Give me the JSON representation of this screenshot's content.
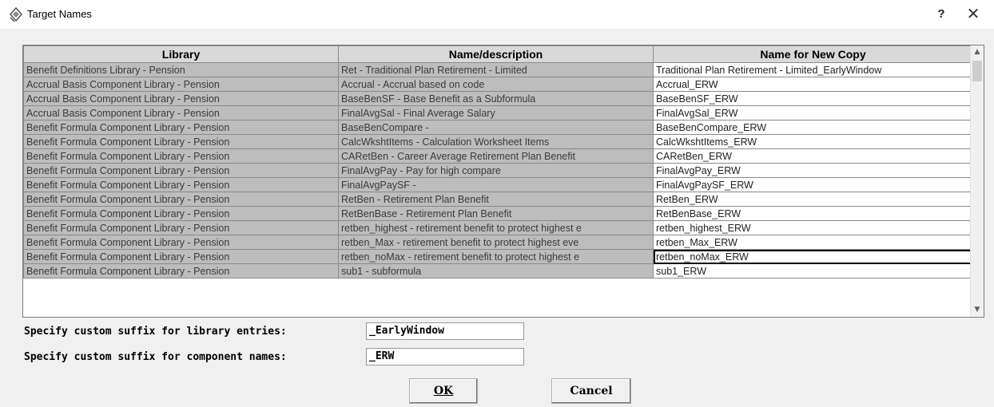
{
  "window": {
    "title": "Target Names",
    "help_label": "?",
    "close_label": "✕",
    "icon": "app-icon"
  },
  "table": {
    "columns": [
      "Library",
      "Name/description",
      "Name for New Copy"
    ],
    "rows": [
      {
        "library": "Benefit Definitions Library - Pension",
        "description": "Ret - Traditional Plan Retirement - Limited",
        "new_name": "Traditional Plan Retirement - Limited_EarlyWindow"
      },
      {
        "library": "Accrual Basis Component Library - Pension",
        "description": "Accrual - Accrual based on code",
        "new_name": "Accrual_ERW"
      },
      {
        "library": "Accrual Basis Component Library - Pension",
        "description": "BaseBenSF - Base Benefit as a Subformula",
        "new_name": "BaseBenSF_ERW"
      },
      {
        "library": "Accrual Basis Component Library - Pension",
        "description": "FinalAvgSal - Final Average Salary",
        "new_name": "FinalAvgSal_ERW"
      },
      {
        "library": "Benefit Formula Component Library - Pension",
        "description": "BaseBenCompare -",
        "new_name": "BaseBenCompare_ERW"
      },
      {
        "library": "Benefit Formula Component Library - Pension",
        "description": "CalcWkshtItems - Calculation Worksheet Items",
        "new_name": "CalcWkshtItems_ERW"
      },
      {
        "library": "Benefit Formula Component Library - Pension",
        "description": "CARetBen - Career Average Retirement Plan Benefit",
        "new_name": "CARetBen_ERW"
      },
      {
        "library": "Benefit Formula Component Library - Pension",
        "description": "FinalAvgPay - Pay for high compare",
        "new_name": "FinalAvgPay_ERW"
      },
      {
        "library": "Benefit Formula Component Library - Pension",
        "description": "FinalAvgPaySF -",
        "new_name": "FinalAvgPaySF_ERW"
      },
      {
        "library": "Benefit Formula Component Library - Pension",
        "description": "RetBen - Retirement Plan Benefit",
        "new_name": "RetBen_ERW"
      },
      {
        "library": "Benefit Formula Component Library - Pension",
        "description": "RetBenBase - Retirement Plan Benefit",
        "new_name": "RetBenBase_ERW"
      },
      {
        "library": "Benefit Formula Component Library - Pension",
        "description": "retben_highest - retirement benefit to protect highest e",
        "new_name": "retben_highest_ERW"
      },
      {
        "library": "Benefit Formula Component Library - Pension",
        "description": "retben_Max - retirement benefit to protect highest eve",
        "new_name": "retben_Max_ERW"
      },
      {
        "library": "Benefit Formula Component Library - Pension",
        "description": "retben_noMax - retirement benefit to protect highest e",
        "new_name": "retben_noMax_ERW"
      },
      {
        "library": "Benefit Formula Component Library - Pension",
        "description": "sub1 - subformula",
        "new_name": "sub1_ERW"
      }
    ]
  },
  "form": {
    "library_suffix_label": "Specify custom suffix for library entries:",
    "library_suffix_value": "_EarlyWindow",
    "component_suffix_label": "Specify custom suffix for component names:",
    "component_suffix_value": "_ERW"
  },
  "buttons": {
    "ok_label": "OK",
    "cancel_label": "Cancel"
  }
}
